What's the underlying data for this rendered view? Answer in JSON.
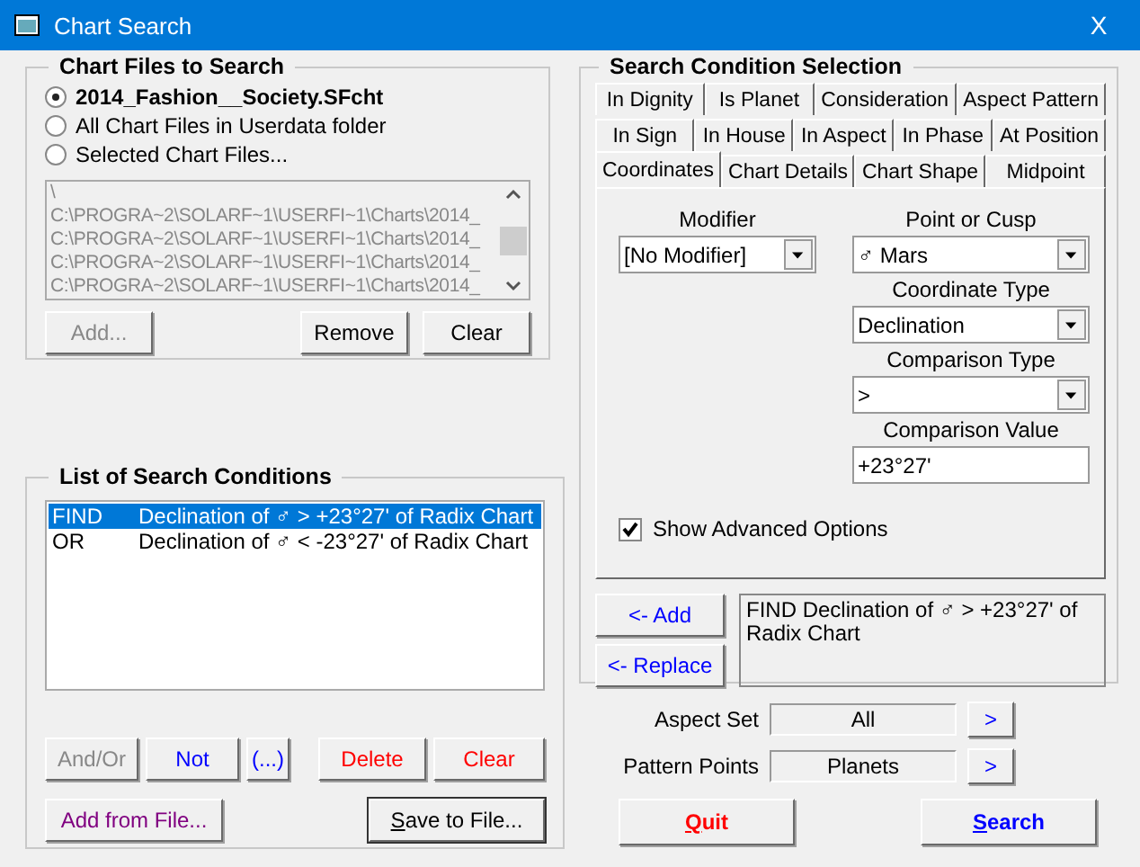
{
  "window": {
    "title": "Chart Search",
    "close": "X"
  },
  "chart_files": {
    "title": "Chart Files to Search",
    "options": [
      {
        "label": "2014_Fashion__Society.SFcht",
        "selected": true
      },
      {
        "label": "All Chart Files in Userdata folder",
        "selected": false
      },
      {
        "label": "Selected Chart Files...",
        "selected": false
      }
    ],
    "files": [
      "\\",
      "C:\\PROGRA~2\\SOLARF~1\\USERFI~1\\Charts\\2014_",
      "C:\\PROGRA~2\\SOLARF~1\\USERFI~1\\Charts\\2014_",
      "C:\\PROGRA~2\\SOLARF~1\\USERFI~1\\Charts\\2014_",
      "C:\\PROGRA~2\\SOLARF~1\\USERFI~1\\Charts\\2014_"
    ],
    "buttons": [
      {
        "label": "Add...",
        "disabled": true
      },
      {
        "label": "Remove",
        "disabled": false
      },
      {
        "label": "Clear",
        "disabled": false
      }
    ]
  },
  "conditions": {
    "title": "List of Search Conditions",
    "rows": [
      {
        "op": "FIND",
        "text": "Declination of ♂ > +23°27' of Radix Chart",
        "selected": true
      },
      {
        "op": "OR",
        "text": "Declination of ♂ < -23°27' of Radix Chart",
        "selected": false
      }
    ],
    "buttons": [
      {
        "label": "And/Or",
        "kind": "disabled"
      },
      {
        "label": "Not",
        "kind": "blue"
      },
      {
        "label": "(...)",
        "kind": "blue"
      },
      {
        "label": "Delete",
        "kind": "red"
      },
      {
        "label": "Clear",
        "kind": "red"
      }
    ],
    "file_buttons": [
      {
        "label": "Add from File...",
        "focused": false
      },
      {
        "label": "Save to File...",
        "focused": true
      }
    ]
  },
  "selection": {
    "title": "Search Condition Selection",
    "tab_rows": [
      [
        {
          "label": "In Dignity",
          "selected": false
        },
        {
          "label": "Is Planet",
          "selected": false
        },
        {
          "label": "Consideration",
          "selected": false
        },
        {
          "label": "Aspect Pattern",
          "selected": false
        }
      ],
      [
        {
          "label": "In Sign",
          "selected": false
        },
        {
          "label": "In House",
          "selected": false
        },
        {
          "label": "In Aspect",
          "selected": false
        },
        {
          "label": "In Phase",
          "selected": false
        },
        {
          "label": "At Position",
          "selected": false
        }
      ],
      [
        {
          "label": "Coordinates",
          "selected": true
        },
        {
          "label": "Chart Details",
          "selected": false
        },
        {
          "label": "Chart Shape",
          "selected": false
        },
        {
          "label": "Midpoint",
          "selected": false
        }
      ]
    ],
    "modifier": {
      "label": "Modifier",
      "value": "[No Modifier]"
    },
    "point": {
      "label": "Point or Cusp",
      "value": "♂ Mars"
    },
    "coordinate_type": {
      "label": "Coordinate Type",
      "value": "Declination"
    },
    "comparison_type": {
      "label": "Comparison Type",
      "value": ">"
    },
    "comparison_value": {
      "label": "Comparison Value",
      "value": "+23°27'"
    },
    "advanced": {
      "label": "Show Advanced Options",
      "checked": true
    },
    "add_button": "<- Add",
    "replace_button": "<- Replace",
    "preview": "FIND   Declination of ♂ > +23°27' of Radix Chart"
  },
  "aspect_set": {
    "label": "Aspect Set",
    "value": "All",
    "button": ">"
  },
  "pattern_points": {
    "label": "Pattern Points",
    "value": "Planets",
    "button": ">"
  },
  "quit": "Quit",
  "search": "Search"
}
